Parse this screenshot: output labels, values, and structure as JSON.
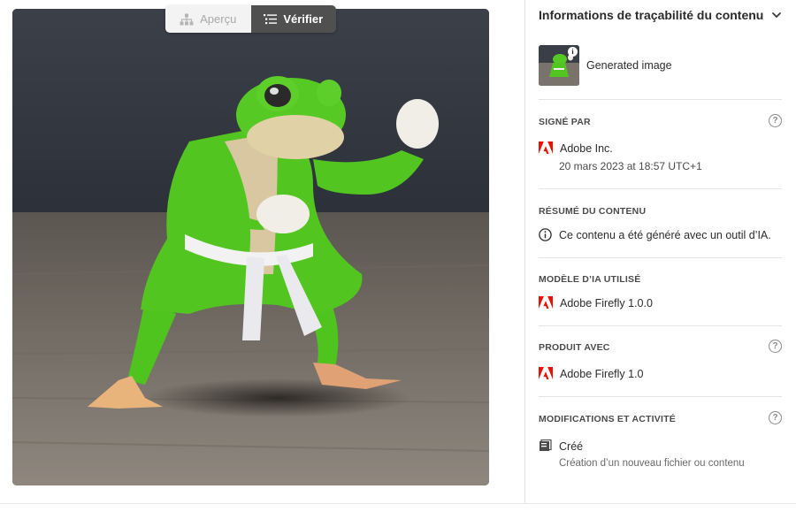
{
  "toggle": {
    "preview_label": "Aperçu",
    "verify_label": "Vérifier",
    "active": "verify"
  },
  "panel": {
    "title": "Informations de traçabilité du contenu",
    "generated_label": "Generated image",
    "signed_by": {
      "label": "SIGNÉ PAR",
      "issuer": "Adobe Inc.",
      "date": "20 mars 2023 at 18:57 UTC+1"
    },
    "content_summary": {
      "label": "RÉSUMÉ DU CONTENU",
      "text": "Ce contenu a été généré avec un outil d’IA."
    },
    "ai_model": {
      "label": "MODÈLE D’IA UTILISÉ",
      "value": "Adobe Firefly 1.0.0"
    },
    "produced_with": {
      "label": "PRODUIT AVEC",
      "value": "Adobe Firefly 1.0"
    },
    "edits": {
      "label": "MODIFICATIONS ET ACTIVITÉ",
      "action": "Créé",
      "description": "Création d’un nouveau fichier ou contenu"
    }
  },
  "icons": {
    "preview": "hierarchy-icon",
    "verify": "list-icon",
    "collapse": "chevron-down-icon",
    "help": "help-circle-icon",
    "issuer": "adobe-logo-icon",
    "summary": "info-circle-icon",
    "action": "file-created-icon"
  },
  "colors": {
    "adobe_red": "#eb1000",
    "toggle_active": "#505050",
    "toggle_inactive": "#f3f3f3"
  }
}
